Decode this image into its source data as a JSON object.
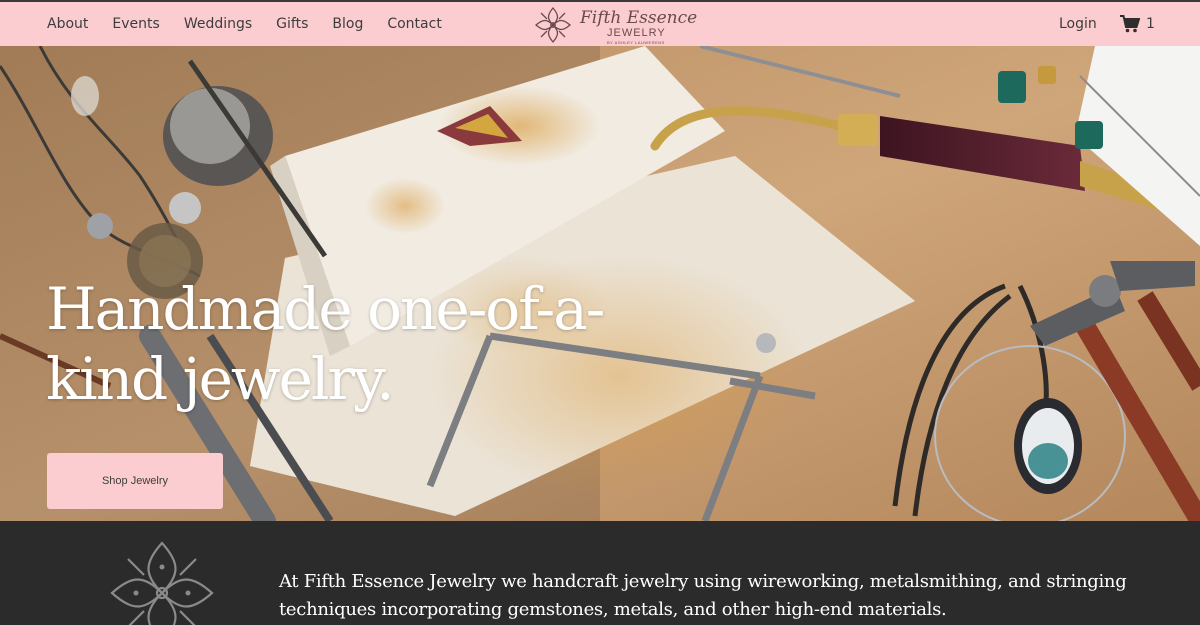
{
  "nav": {
    "items": [
      "About",
      "Events",
      "Weddings",
      "Gifts",
      "Blog",
      "Contact"
    ]
  },
  "brand": {
    "name": "Fifth Essence",
    "sub": "JEWELRY",
    "tagline": "BY ASHLEY LAUWERENS"
  },
  "account": {
    "login": "Login",
    "cart_count": "1"
  },
  "hero": {
    "headline": "Handmade one-of-a-kind jewelry.",
    "cta": "Shop Jewelry"
  },
  "intro": {
    "text": "At Fifth Essence Jewelry we handcraft jewelry using  wireworking, metalsmithing, and stringing techniques incorporating gemstones, metals,  and other high-end materials."
  },
  "colors": {
    "header_bg": "#fbcdd0",
    "band_bg": "#2b2b2b",
    "brand_text": "#6b4a4e"
  }
}
